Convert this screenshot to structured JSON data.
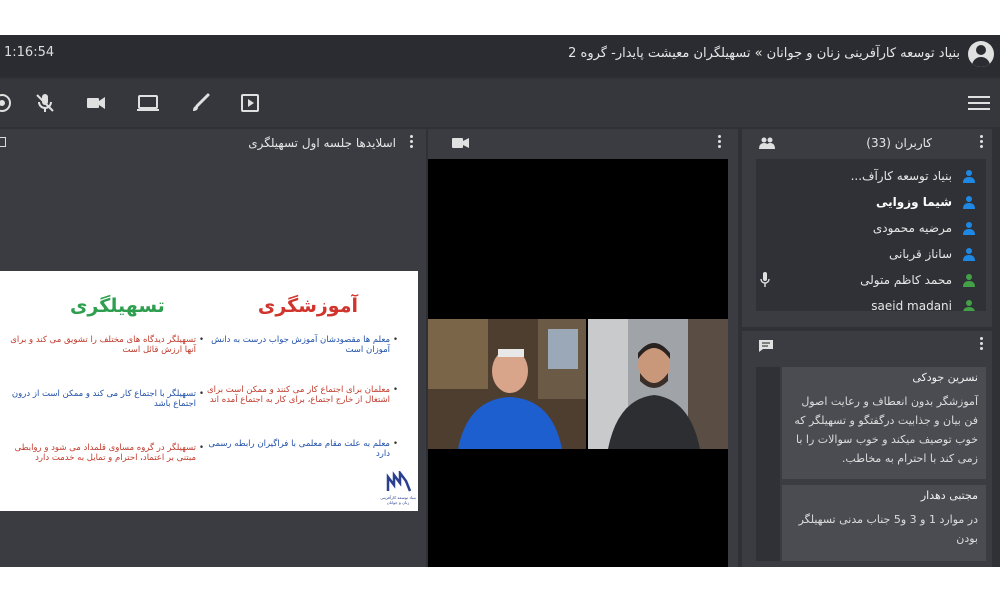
{
  "header": {
    "clock": "1:16:54",
    "title": "بنیاد توسعه کارآفرینی زنان و جوانان » تسهیلگران معیشت پایدار- گروه 2"
  },
  "toolbar": {
    "icons": [
      "audio-icon",
      "mic-muted-icon",
      "camera-icon",
      "screen-share-icon",
      "brush-icon",
      "play-icon",
      "menu-icon"
    ]
  },
  "slides": {
    "title": "اسلایدها جلسه اول تسهیلگری",
    "left_heading": "تسهیلگری",
    "right_heading": "آموزشگری",
    "left_bullets": [
      "تسهیلگر دیدگاه های مختلف را تشویق می کند و برای آنها ارزش قائل است",
      "تسهیلگر با اجتماع کار می کند و ممکن است از درون اجتماع باشد",
      "تسهیلگر در گروه مساوی قلمداد می شود و روابطی مبتنی بر اعتماد، احترام و تمایل به خدمت دارد"
    ],
    "right_bullets": [
      "معلم ها مقصودشان آموزش جواب درست به دانش آموزان است",
      "معلمان برای اجتماع کار می کنند و ممکن است برای اشتغال از خارج اجتماع، برای کار به اجتماع آمده اند",
      "معلم به علت مقام معلمی با فراگیران رابطه رسمی دارد"
    ],
    "logo_text": "بنیاد توسعه کارآفرینی زنان و جوانان",
    "colors": {
      "right_heading": "#d0342c",
      "left_heading": "#2e9e4f",
      "right_text": "#c0392b",
      "left_text": "#c0392b",
      "blue_text": "#1f4fa8"
    }
  },
  "users": {
    "title": "کاربران (33)",
    "items": [
      {
        "name": "بنیاد توسعه کارآف...",
        "icon": "user-icon",
        "color": "#1e88e5",
        "bold": false
      },
      {
        "name": "شیما وزوایی",
        "icon": "user-icon",
        "color": "#1e88e5",
        "bold": true
      },
      {
        "name": "مرضیه محمودی",
        "icon": "user-icon",
        "color": "#1e88e5",
        "bold": false
      },
      {
        "name": "ساناز قربانی",
        "icon": "user-icon",
        "color": "#1e88e5",
        "bold": false
      },
      {
        "name": "محمد کاظم متولی",
        "icon": "user-icon",
        "color": "#43a047",
        "bold": false,
        "mic": true
      },
      {
        "name": "saeid madani",
        "icon": "user-icon",
        "color": "#43a047",
        "bold": false
      }
    ]
  },
  "chat": {
    "messages": [
      {
        "sender": "نسرین جودکی",
        "text": "آموزشگر بدون انعطاف و رعایت اصول فن بیان و جذابیت درگفتگو و تسهیلگر که خوب توصیف میکند و خوب سوالات را با زمی کند با احترام به مخاطب."
      },
      {
        "sender": "مجتبی دهدار",
        "text": "در موارد 1 و 3 و5 جناب مدنی تسهیلگر بودن"
      }
    ]
  }
}
